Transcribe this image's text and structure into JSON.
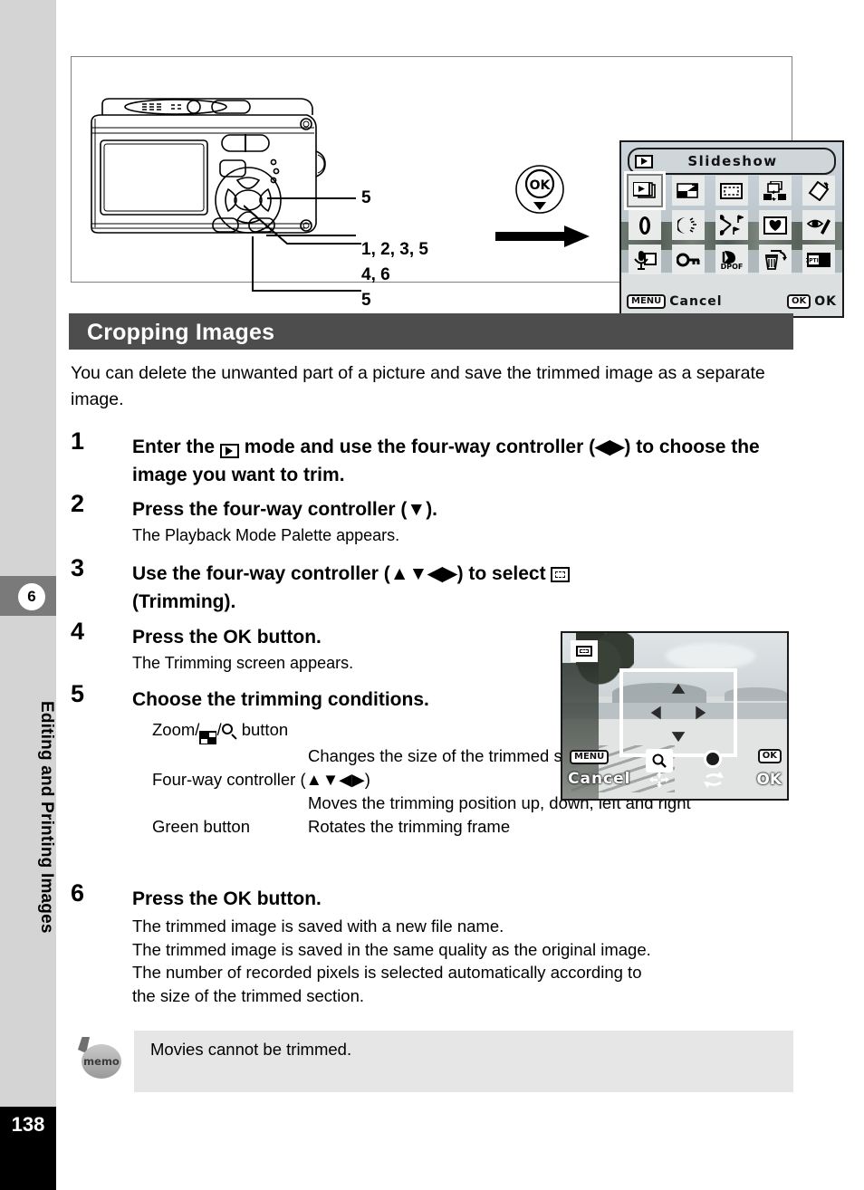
{
  "page": {
    "number": "138",
    "chapter_number": "6",
    "chapter_title": "Editing and Printing Images"
  },
  "illustration": {
    "callouts": [
      {
        "id": "callout-zoom",
        "label": "5"
      },
      {
        "id": "callout-fourway",
        "label": "1, 2, 3, 5"
      },
      {
        "id": "callout-ok",
        "label": "4, 6"
      },
      {
        "id": "callout-green",
        "label": "5"
      }
    ],
    "ok_key_label": "OK",
    "arrow": "right-arrow"
  },
  "lcd_screen": {
    "mode_icon": "playback-icon",
    "title": "Slideshow",
    "palette_rows": [
      [
        {
          "name": "slideshow-icon",
          "selected": true
        },
        {
          "name": "image-rotation-icon",
          "selected": false
        },
        {
          "name": "trimming-icon",
          "selected": false
        },
        {
          "name": "image-copy-icon",
          "selected": false
        },
        {
          "name": "digital-filter-icon",
          "selected": false
        }
      ],
      [
        {
          "name": "brightness-filter-icon",
          "selected": false
        },
        {
          "name": "frame-composite-icon",
          "selected": false
        },
        {
          "name": "movie-edit-icon",
          "selected": false
        },
        {
          "name": "favorite-icon",
          "selected": false
        },
        {
          "name": "red-eye-compensation-icon",
          "selected": false
        }
      ],
      [
        {
          "name": "voice-memo-icon",
          "selected": false
        },
        {
          "name": "protect-icon",
          "selected": false
        },
        {
          "name": "dpof-icon",
          "selected": false
        },
        {
          "name": "delete-icon",
          "selected": false
        },
        {
          "name": "start-up-screen-icon",
          "selected": false
        }
      ]
    ],
    "menu_key": "MENU",
    "menu_label": "Cancel",
    "ok_key": "OK",
    "ok_label": "OK"
  },
  "heading": "Cropping Images",
  "intro": "You can delete the unwanted part of a picture and save the trimmed image as a separate image.",
  "steps": [
    {
      "number": "1",
      "title_pre": "Enter the ",
      "title_icon": "playback-mode-icon",
      "title_post": " mode and use the four-way controller (◀▶) to choose the image you want to trim.",
      "body": ""
    },
    {
      "number": "2",
      "title_pre": "Press the four-way controller (▼).",
      "title_icon": "",
      "title_post": "",
      "body": "The Playback Mode Palette appears."
    },
    {
      "number": "3",
      "title_pre": "Use the four-way controller (▲▼◀▶) to select ",
      "title_icon": "trimming-icon",
      "title_post": "(Trimming).",
      "body": ""
    },
    {
      "number": "4",
      "title_pre": "Press the OK button.",
      "title_icon": "",
      "title_post": "",
      "body": "The Trimming screen appears."
    },
    {
      "number": "5",
      "title_pre": "Choose the trimming conditions.",
      "title_icon": "",
      "title_post": "",
      "body": ""
    },
    {
      "number": "6",
      "title_pre": "Press the OK button.",
      "title_icon": "",
      "title_post": "",
      "body": ""
    }
  ],
  "step5_table": [
    {
      "control_pre": "Zoom/",
      "control_icons": [
        "multi-image-icon",
        "magnifier-icon"
      ],
      "control_post": " button",
      "desc": "Changes the size of the trimmed section"
    },
    {
      "control_pre": "Four-way controller (▲▼◀▶)",
      "control_icons": [],
      "control_post": "",
      "desc": "Moves the trimming position up, down, left and right"
    },
    {
      "control_pre": "Green button",
      "control_icons": [],
      "control_post": "",
      "desc": "Rotates the trimming frame"
    }
  ],
  "step6_lines": [
    "The trimmed image is saved with a new file name.",
    "The trimmed image is saved in the same quality as the original image.",
    "The number of recorded pixels is selected automatically according to",
    "the size of the trimmed section."
  ],
  "trimming_screen": {
    "mode_icon": "trimming-icon",
    "menu_key": "MENU",
    "cancel_label": "Cancel",
    "zoom_icon": "magnifier-icon",
    "move_icon": "move-cross-icon",
    "green_icon": "green-button-icon",
    "rotate_icon": "rotate-icon",
    "ok_key": "OK",
    "ok_label": "OK",
    "frame_arrows": [
      "up",
      "down",
      "left",
      "right"
    ]
  },
  "memo": {
    "icon_label": "memo",
    "text": "Movies cannot be trimmed."
  }
}
